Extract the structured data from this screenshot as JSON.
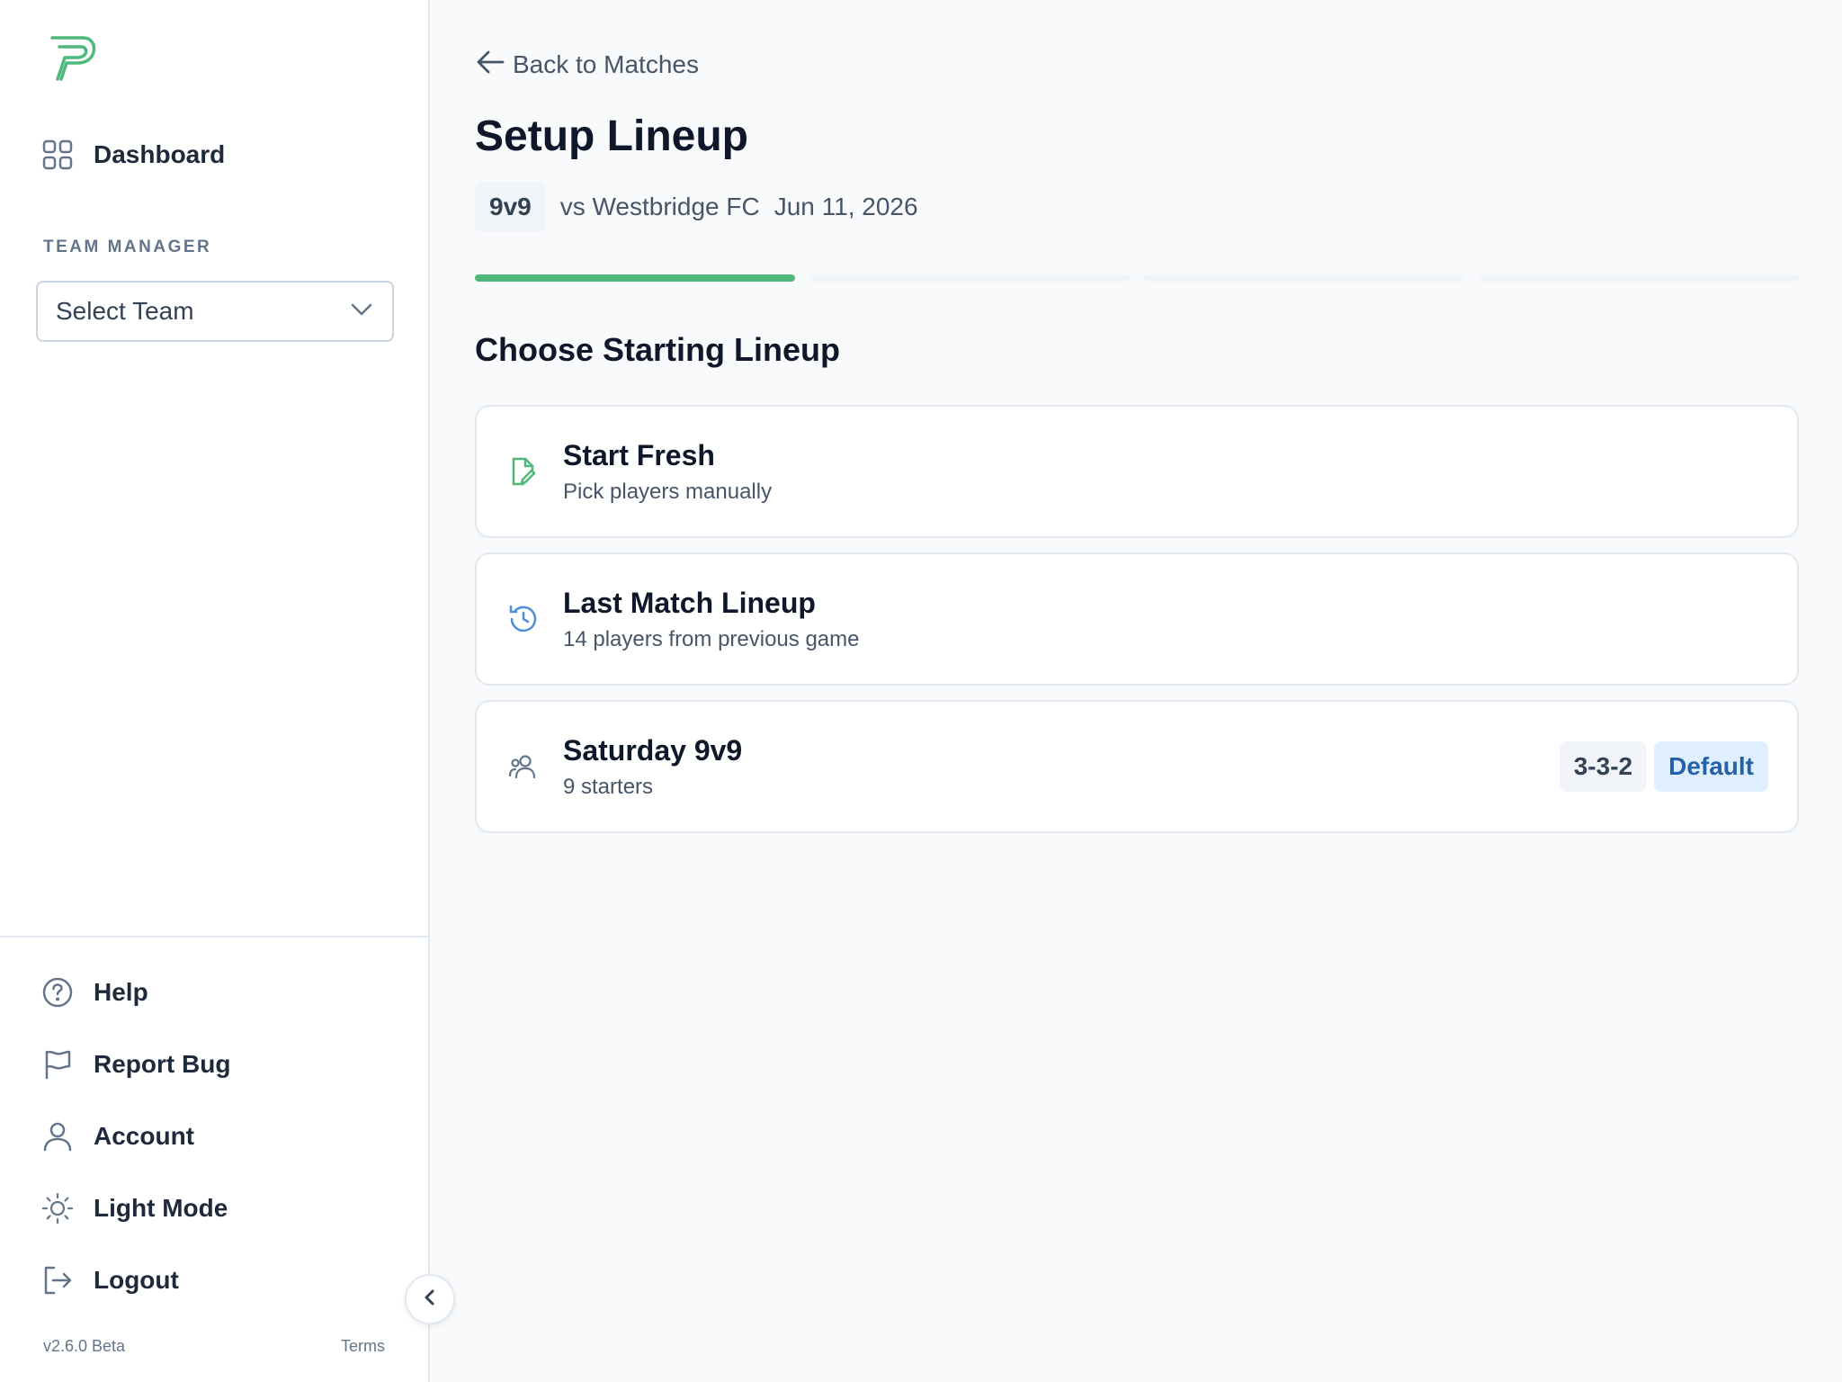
{
  "sidebar": {
    "logo_icon": "brand-p-logo",
    "nav": {
      "dashboard_label": "Dashboard"
    },
    "section_label": "TEAM MANAGER",
    "team_select": {
      "value": "Select Team"
    },
    "footer_nav": {
      "help_label": "Help",
      "report_bug_label": "Report Bug",
      "account_label": "Account",
      "light_mode_label": "Light Mode",
      "logout_label": "Logout"
    },
    "version": "v2.6.0 Beta",
    "terms": "Terms"
  },
  "main": {
    "back_label": "Back to Matches",
    "page_title": "Setup Lineup",
    "format_badge": "9v9",
    "opponent": "vs Westbridge FC",
    "date": "Jun 11, 2026",
    "progress": {
      "current_step": 1,
      "total_steps": 4
    },
    "section_title": "Choose Starting Lineup",
    "options": [
      {
        "title": "Start Fresh",
        "subtitle": "Pick players manually",
        "icon": "edit-file-icon"
      },
      {
        "title": "Last Match Lineup",
        "subtitle": "14 players from previous game",
        "icon": "history-icon"
      },
      {
        "title": "Saturday 9v9",
        "subtitle": "9 starters",
        "icon": "users-icon",
        "formation": "3-3-2",
        "default_tag": "Default"
      }
    ]
  },
  "colors": {
    "accent_green": "#4fb87c",
    "accent_blue": "#4a8fd8",
    "default_tag_bg": "#e0efff",
    "default_tag_text": "#2563a8"
  }
}
